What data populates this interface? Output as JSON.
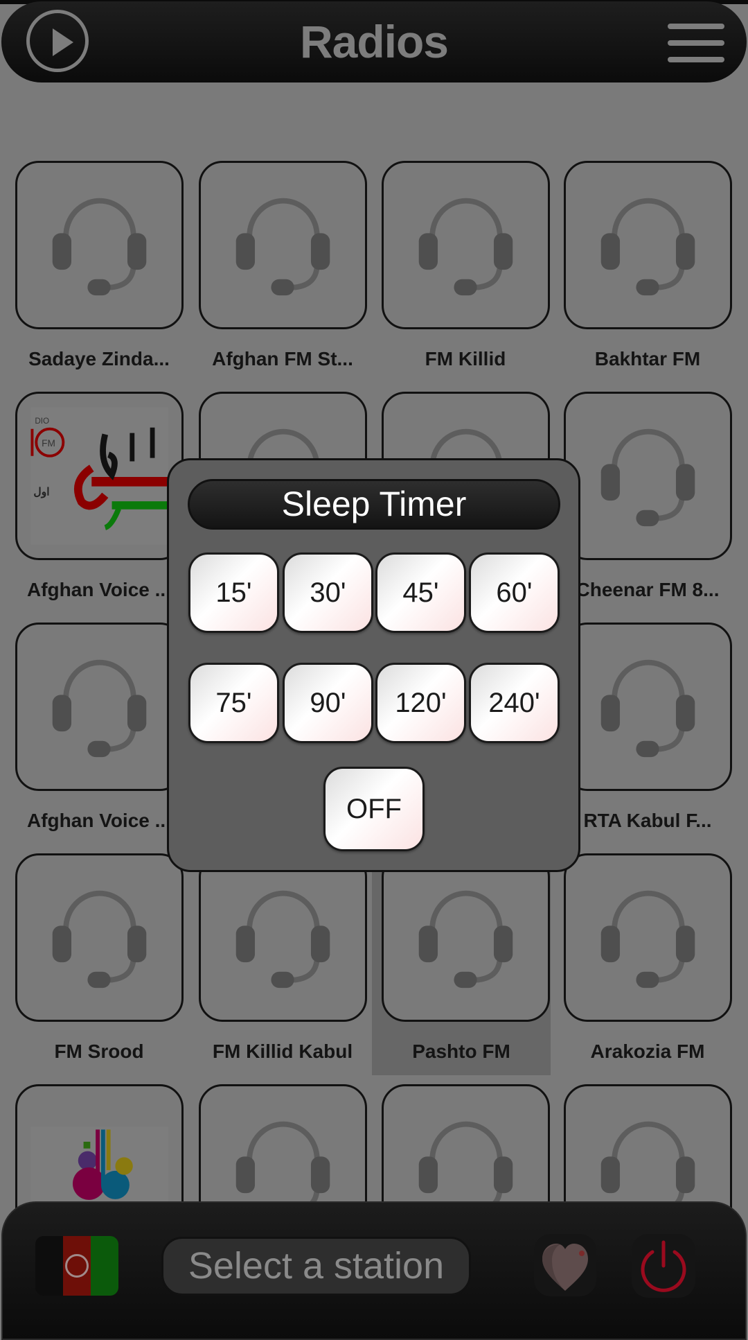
{
  "header": {
    "title": "Radios",
    "play_icon": "play-circle-icon",
    "menu_icon": "hamburger-menu-icon"
  },
  "stations": [
    {
      "name": "Sadaye Zinda...",
      "logo": "headset"
    },
    {
      "name": "Afghan FM St...",
      "logo": "headset"
    },
    {
      "name": "FM Killid",
      "logo": "headset"
    },
    {
      "name": "Bakhtar FM",
      "logo": "headset"
    },
    {
      "name": "Afghan Voice ...",
      "logo": "sadaye-afghan"
    },
    {
      "name": "",
      "logo": "headset"
    },
    {
      "name": "",
      "logo": "headset"
    },
    {
      "name": "Cheenar FM 8...",
      "logo": "headset"
    },
    {
      "name": "Afghan Voice ...",
      "logo": "headset"
    },
    {
      "name": "",
      "logo": "headset"
    },
    {
      "name": "",
      "logo": "headset"
    },
    {
      "name": "RTA Kabul F...",
      "logo": "headset"
    },
    {
      "name": "FM Srood",
      "logo": "headset"
    },
    {
      "name": "FM Killid Kabul",
      "logo": "headset"
    },
    {
      "name": "Pashto FM",
      "logo": "headset",
      "highlighted": true
    },
    {
      "name": "Arakozia FM",
      "logo": "headset"
    },
    {
      "name": "",
      "logo": "arman"
    },
    {
      "name": "",
      "logo": "headset"
    },
    {
      "name": "",
      "logo": "headset"
    },
    {
      "name": "",
      "logo": "headset"
    }
  ],
  "sleep_timer": {
    "title": "Sleep Timer",
    "options": [
      "15'",
      "30'",
      "45'",
      "60'",
      "75'",
      "90'",
      "120'",
      "240'"
    ],
    "off_label": "OFF"
  },
  "footer": {
    "country_flag": "afghanistan-flag",
    "station_placeholder": "Select a station",
    "favorite_icon": "heart-icon",
    "power_icon": "power-icon"
  },
  "colors": {
    "background_dimmed": "#7a7a7a",
    "bar": "#111111",
    "dialog": "#5d5d5d",
    "power": "#9a0a1e",
    "flag_black": "#0d0d0d",
    "flag_red": "#6e0f08",
    "flag_green": "#0b5a0b"
  }
}
